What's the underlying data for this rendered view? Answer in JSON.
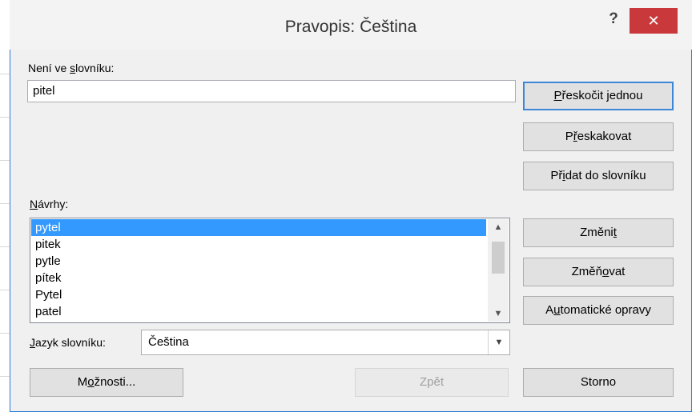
{
  "dialog": {
    "title": "Pravopis: Čeština",
    "help_label": "?",
    "close_label": "✕"
  },
  "not_in_dictionary": {
    "label_before": "Není ve ",
    "label_accel": "s",
    "label_after": "lovníku:",
    "value": "pitel"
  },
  "suggestions": {
    "label_accel": "N",
    "label_after": "ávrhy:",
    "items": [
      "pytel",
      "pitek",
      "pytle",
      "pítek",
      "Pytel",
      "patel"
    ],
    "selected": "pytel"
  },
  "language": {
    "label_accel": "J",
    "label_after": "azyk slovníku:",
    "value": "Čeština"
  },
  "buttons": {
    "ignore_once": {
      "accel": "P",
      "rest": "řeskočit jednou"
    },
    "ignore_all": {
      "before": "P",
      "accel": "ř",
      "rest": "eskakovat"
    },
    "add_to_dictionary": {
      "before": "Př",
      "accel": "i",
      "rest": "dat do slovníku"
    },
    "change": {
      "before": "Změni",
      "accel": "t",
      "rest": ""
    },
    "change_all": {
      "before": "Změň",
      "accel": "o",
      "rest": "vat"
    },
    "autocorrect": {
      "before": "A",
      "accel": "u",
      "rest": "tomatické opravy"
    },
    "options": {
      "before": "M",
      "accel": "o",
      "rest": "žnosti..."
    },
    "undo": "Zpět",
    "cancel": "Storno"
  }
}
